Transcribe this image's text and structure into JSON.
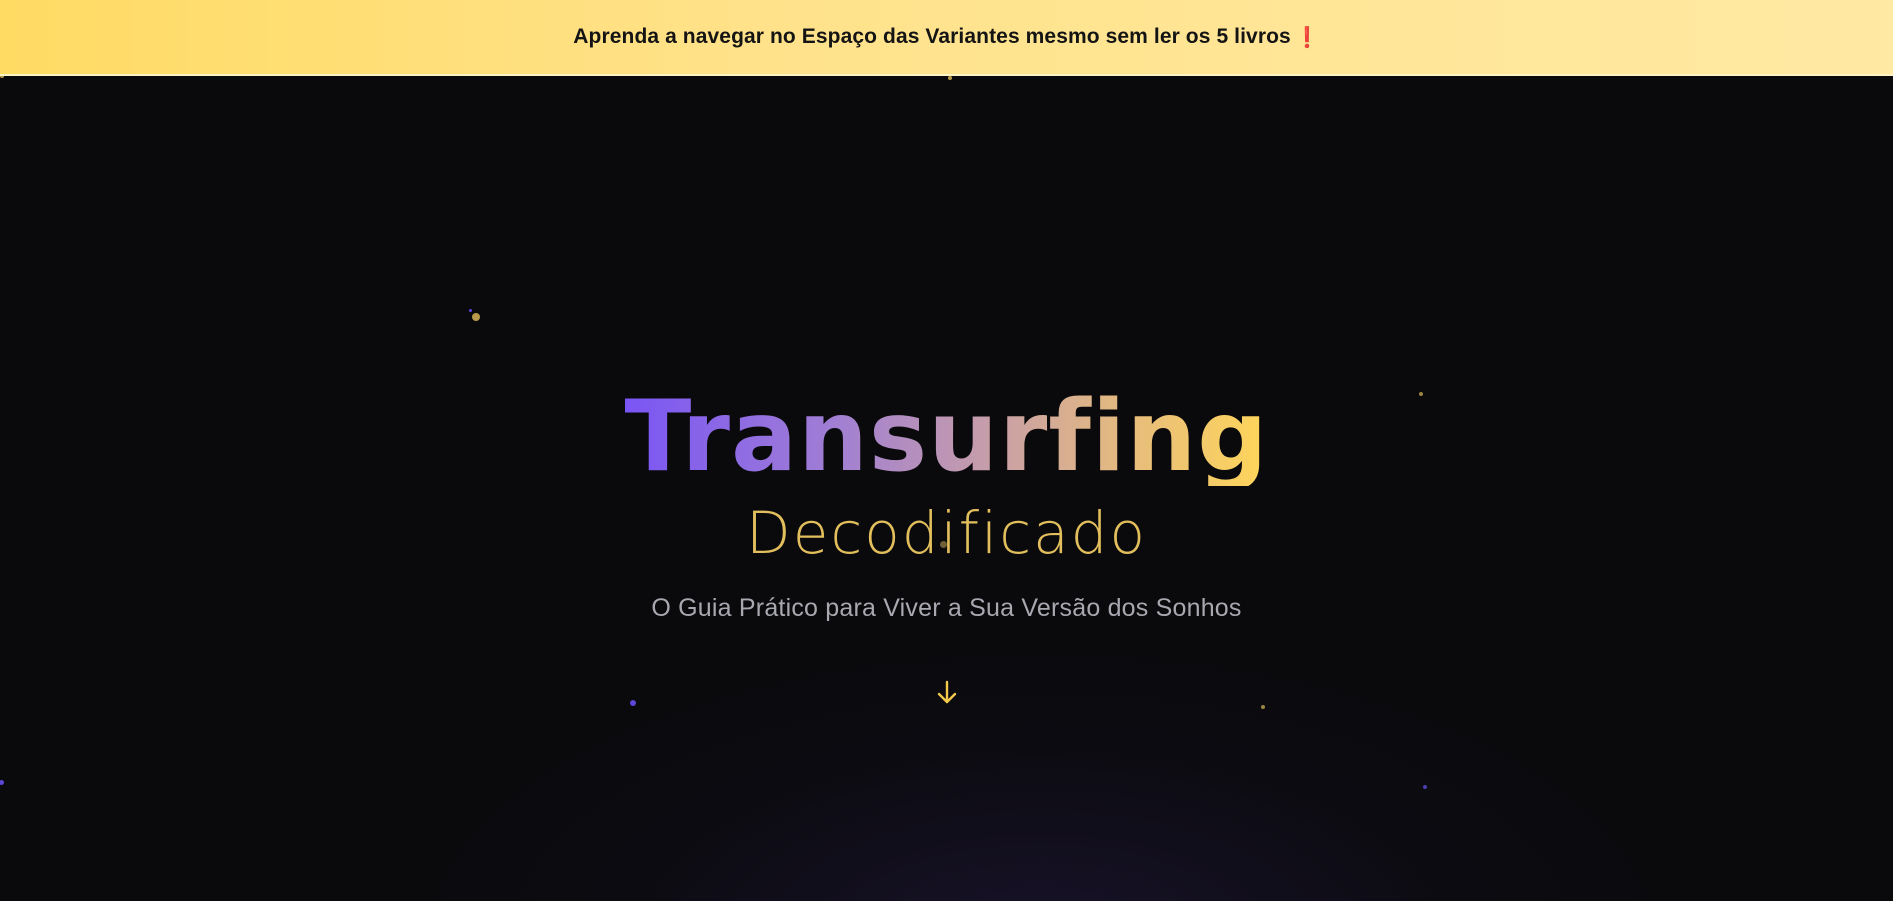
{
  "banner": {
    "text": "Aprenda a navegar no Espaço das Variantes mesmo sem ler os 5 livros",
    "emoji": "❗"
  },
  "hero": {
    "title": "Transurfing",
    "subtitle": "Decodificado",
    "tagline": "O Guia Prático para Viver a Sua Versão dos Sonhos",
    "scroll_icon": "arrow-down-icon"
  },
  "colors": {
    "banner_bg": "#ffe28a",
    "background": "#0a0a0c",
    "title_gradient_start": "#7a55f5",
    "title_gradient_end": "#ffd65a",
    "subtitle": "#e2bf5c",
    "tagline": "#a8a8b0",
    "accent_gold": "#f2c94c",
    "accent_purple": "#5b48d8"
  }
}
